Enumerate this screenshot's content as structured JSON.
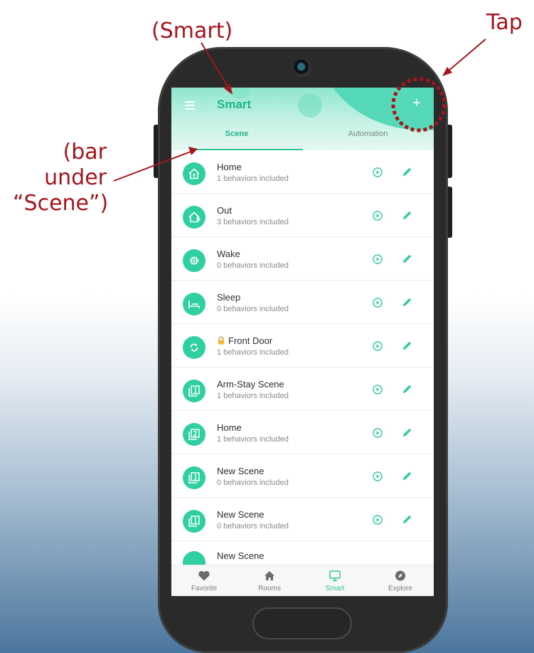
{
  "annotations": {
    "tap": "Tap",
    "smart": "(Smart)",
    "bar_lines": [
      "(bar",
      "under",
      "“Scene”)"
    ]
  },
  "header": {
    "title": "Smart",
    "menu_icon": "hamburger-menu-icon",
    "add_label": "+"
  },
  "tabs": [
    {
      "label": "Scene",
      "active": true
    },
    {
      "label": "Automation",
      "active": false
    }
  ],
  "scenes": [
    {
      "name": "Home",
      "subtitle": "1 behaviors included",
      "icon": "house-icon"
    },
    {
      "name": "Out",
      "subtitle": "3 behaviors included",
      "icon": "house-out-icon"
    },
    {
      "name": "Wake",
      "subtitle": "0 behaviors included",
      "icon": "gear-icon"
    },
    {
      "name": "Sleep",
      "subtitle": "0 behaviors included",
      "icon": "bed-icon"
    },
    {
      "name": "Front Door",
      "subtitle": "1 behaviors included",
      "icon": "sync-icon",
      "locked": true
    },
    {
      "name": "Arm-Stay Scene",
      "subtitle": "1 behaviors included",
      "icon": "layers-1-icon"
    },
    {
      "name": "Home",
      "subtitle": "1 behaviors included",
      "icon": "layers-2-icon"
    },
    {
      "name": "New Scene",
      "subtitle": "0 behaviors included",
      "icon": "layers-1-icon"
    },
    {
      "name": "New Scene",
      "subtitle": "0 behaviors included",
      "icon": "layers-1-icon"
    }
  ],
  "partial_row": {
    "name": "New Scene"
  },
  "bottom_nav": [
    {
      "label": "Favorite",
      "icon": "heart-icon"
    },
    {
      "label": "Rooms",
      "icon": "home-icon"
    },
    {
      "label": "Smart",
      "icon": "monitor-icon",
      "active": true
    },
    {
      "label": "Explore",
      "icon": "compass-icon"
    }
  ],
  "colors": {
    "accent": "#2fc9a0",
    "annotation": "#a5151c",
    "phone_body": "#2a2a2a"
  }
}
